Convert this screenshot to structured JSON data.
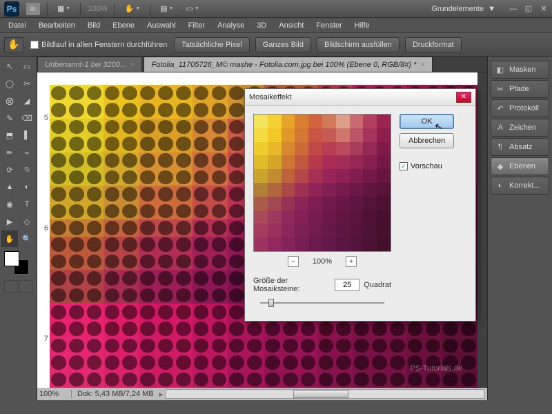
{
  "topbar": {
    "ps": "Ps",
    "br": "Br",
    "zoom": "100%",
    "workspace": "Grundelemente"
  },
  "menu": [
    "Datei",
    "Bearbeiten",
    "Bild",
    "Ebene",
    "Auswahl",
    "Filter",
    "Analyse",
    "3D",
    "Ansicht",
    "Fenster",
    "Hilfe"
  ],
  "options": {
    "scroll_label": "Bildlauf in allen Fenstern durchführen",
    "buttons": [
      "Tatsächliche Pixel",
      "Ganzes Bild",
      "Bildschirm ausfüllen",
      "Druckformat"
    ]
  },
  "tabs": [
    {
      "label": "Unbenannt-1 bei 3200...",
      "active": false
    },
    {
      "label": "Fotolia_11705726_M© mashe - Fotolia.com.jpg bei 100% (Ebene 0, RGB/8#) *",
      "active": true
    }
  ],
  "ruler_v": [
    "5",
    "6",
    "7"
  ],
  "status": {
    "zoom": "100%",
    "doc": "Dok: 5,43 MB/7,24 MB"
  },
  "panels": [
    {
      "icon": "◧",
      "label": "Masken"
    },
    {
      "icon": "✂",
      "label": "Pfade"
    },
    {
      "icon": "↶",
      "label": "Protokoll"
    },
    {
      "icon": "A",
      "label": "Zeichen"
    },
    {
      "icon": "¶",
      "label": "Absatz"
    },
    {
      "icon": "◆",
      "label": "Ebenen",
      "active": true
    },
    {
      "icon": "◐",
      "label": "Korrekt..."
    }
  ],
  "dialog": {
    "title": "Mosaikeffekt",
    "ok": "OK",
    "cancel": "Abbrechen",
    "preview_label": "Vorschau",
    "preview_zoom": "100%",
    "size_label": "Größe der Mosaiksteine:",
    "size_value": "25",
    "size_unit": "Quadrat"
  },
  "watermark": "PS-Tutorials.de",
  "colors": {
    "canvas_cells": [
      "#f0d92e",
      "#ecc21e",
      "#e8b520",
      "#e2a428",
      "#d3932e",
      "#ce5e3c",
      "#c83a4a",
      "#c01f55",
      "#a8154b",
      "#8c1240",
      "#e2cc25",
      "#e4b61e",
      "#d99f27",
      "#d68734",
      "#ce5a45",
      "#c7394f",
      "#bf2456",
      "#af1650",
      "#98134a",
      "#831041",
      "#d3be28",
      "#d4a92b",
      "#d79031",
      "#cf6e3c",
      "#c94849",
      "#c22c53",
      "#b61c55",
      "#a31551",
      "#8f134a",
      "#7c113f",
      "#d0a62a",
      "#c98d33",
      "#cd6b3c",
      "#c54d48",
      "#bd3055",
      "#aa1f56",
      "#9a1752",
      "#8a144b",
      "#7a1242",
      "#6a103a",
      "#c77d31",
      "#c4653b",
      "#be4948",
      "#b52f53",
      "#a72056",
      "#951853",
      "#86144d",
      "#781245",
      "#6a113c",
      "#5c0f33",
      "#bc5a3a",
      "#b74546",
      "#b02d53",
      "#a11f55",
      "#901854",
      "#82144e",
      "#751247",
      "#68113e",
      "#5b1036",
      "#500e2e",
      "#af4244",
      "#a82e51",
      "#9b1f55",
      "#8c1753",
      "#7d134d",
      "#711245",
      "#64103d",
      "#590f36",
      "#4e0e2e",
      "#440c27",
      "#e8226d",
      "#e01d69",
      "#d21863",
      "#bf165e",
      "#ab1459",
      "#9a1352",
      "#8a124b",
      "#7b1144",
      "#6c103c",
      "#5e0f34",
      "#e52670",
      "#dd206a",
      "#cf1b64",
      "#bc175f",
      "#a91559",
      "#971353",
      "#87124b",
      "#791144",
      "#6b103d",
      "#5d0f35",
      "#e02a6f",
      "#d8246a",
      "#ca1e64",
      "#b71a5f",
      "#a51659",
      "#941453",
      "#85134c",
      "#771245",
      "#6a103e",
      "#5c0f36"
    ],
    "pv_cells": [
      "#f2e45e",
      "#f4d033",
      "#e7a32a",
      "#d97e31",
      "#d0643d",
      "#d07a57",
      "#dd9e8a",
      "#c86a6f",
      "#b33e5e",
      "#9c2451",
      "#f3db40",
      "#f2c726",
      "#e09829",
      "#d47634",
      "#c85444",
      "#c65a55",
      "#d0766d",
      "#bb5666",
      "#a4345b",
      "#8e1f4d",
      "#eecd2d",
      "#e8b828",
      "#d68a2d",
      "#cc6b38",
      "#c04848",
      "#b83e52",
      "#ba4a5c",
      "#a73b5a",
      "#942955",
      "#821a49",
      "#e0bc2a",
      "#d8a52b",
      "#cd7733",
      "#c25740",
      "#b63a4c",
      "#ab2d55",
      "#a22d57",
      "#952755",
      "#85204f",
      "#761845",
      "#cba42d",
      "#c38c31",
      "#bf633b",
      "#b44647",
      "#a62f52",
      "#992457",
      "#8e2254",
      "#821e4f",
      "#751a48",
      "#68153f",
      "#af8035",
      "#b0673c",
      "#a94946",
      "#9e3151",
      "#8f2556",
      "#821f53",
      "#771b4e",
      "#6c1847",
      "#62163f",
      "#581336",
      "#aa5c49",
      "#a24851",
      "#973257",
      "#8a2657",
      "#7d1f53",
      "#711b4d",
      "#671847",
      "#5d163f",
      "#541338",
      "#4c1130",
      "#a84a58",
      "#9e3a5b",
      "#90295a",
      "#832156",
      "#771c50",
      "#6c194a",
      "#621743",
      "#59153c",
      "#501234",
      "#48102d",
      "#a33c5d",
      "#98315c",
      "#8a265a",
      "#7d2055",
      "#711b4f",
      "#671949",
      "#5e1742",
      "#55153b",
      "#4d1334",
      "#45112c",
      "#9c3360",
      "#91295e",
      "#84235a",
      "#781e54",
      "#6c1a4e",
      "#631847",
      "#5a1641",
      "#52143b",
      "#4a1233",
      "#43102c"
    ]
  }
}
